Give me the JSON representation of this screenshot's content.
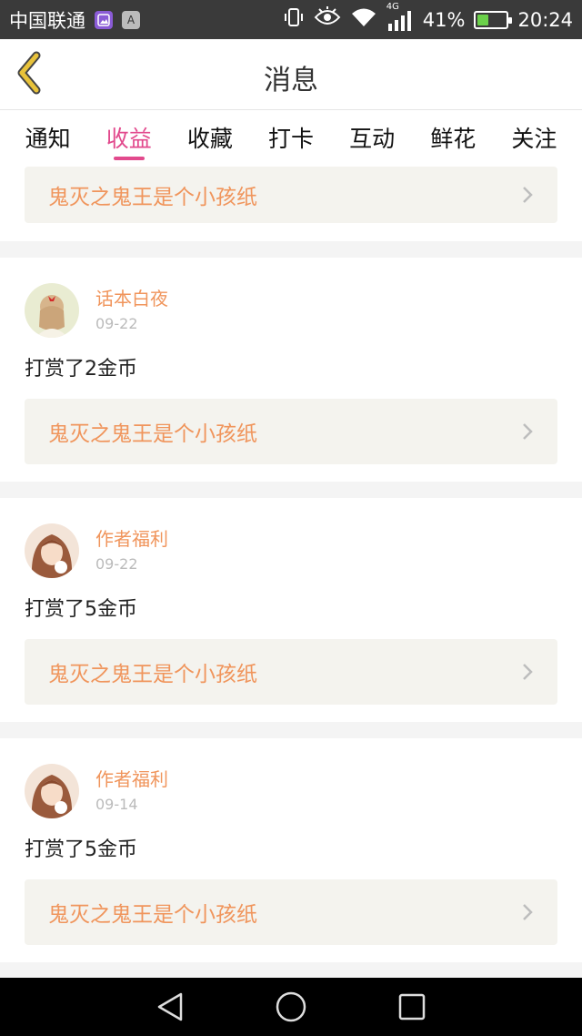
{
  "status_bar": {
    "carrier": "中国联通",
    "badge_a": "A",
    "network": "4G",
    "battery": "41%",
    "battery_level": 0.41,
    "time": "20:24"
  },
  "header": {
    "title": "消息"
  },
  "tabs": [
    {
      "label": "通知",
      "active": false
    },
    {
      "label": "收益",
      "active": true
    },
    {
      "label": "收藏",
      "active": false
    },
    {
      "label": "打卡",
      "active": false
    },
    {
      "label": "互动",
      "active": false
    },
    {
      "label": "鲜花",
      "active": false
    },
    {
      "label": "关注",
      "active": false
    }
  ],
  "messages": {
    "partial": {
      "book_title": "鬼灭之鬼王是个小孩纸"
    },
    "items": [
      {
        "username": "话本白夜",
        "date": "09-22",
        "action": "打赏了2金币",
        "book_title": "鬼灭之鬼王是个小孩纸"
      },
      {
        "username": "作者福利",
        "date": "09-22",
        "action": "打赏了5金币",
        "book_title": "鬼灭之鬼王是个小孩纸"
      },
      {
        "username": "作者福利",
        "date": "09-14",
        "action": "打赏了5金币",
        "book_title": "鬼灭之鬼王是个小孩纸"
      }
    ]
  },
  "colors": {
    "accent": "#e24a8d",
    "orange": "#f0955c",
    "back_arrow": "#e8c23a"
  },
  "icons": [
    "back-arrow-icon",
    "chevron-right-icon",
    "vibrate-icon",
    "eye-icon",
    "wifi-icon",
    "signal-icon",
    "battery-icon",
    "nav-back-icon",
    "nav-home-icon",
    "nav-recent-icon"
  ]
}
